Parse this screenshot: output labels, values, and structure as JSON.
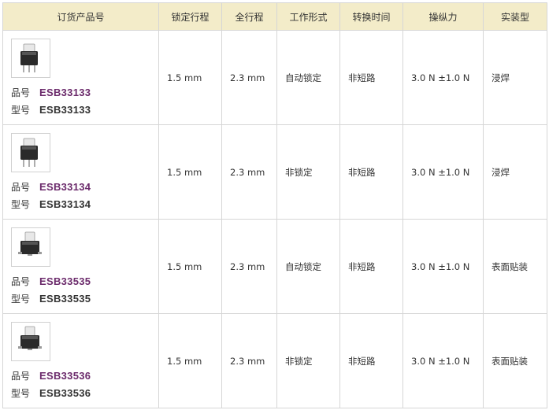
{
  "table": {
    "headers": [
      "订货产品号",
      "锁定行程",
      "全行程",
      "工作形式",
      "转换时间",
      "操纵力",
      "实装型"
    ],
    "label_part": "品号",
    "label_model": "型号",
    "rows": [
      {
        "part_no": "ESB33133",
        "model": "ESB33133",
        "lock_stroke": "1.5 mm",
        "full_stroke": "2.3 mm",
        "operation": "自动锁定",
        "switching": "非短路",
        "force": "3.0 N ±1.0 N",
        "mounting": "浸焊",
        "image_icon": "switch-dip-icon"
      },
      {
        "part_no": "ESB33134",
        "model": "ESB33134",
        "lock_stroke": "1.5 mm",
        "full_stroke": "2.3 mm",
        "operation": "非锁定",
        "switching": "非短路",
        "force": "3.0 N ±1.0 N",
        "mounting": "浸焊",
        "image_icon": "switch-dip-icon"
      },
      {
        "part_no": "ESB33535",
        "model": "ESB33535",
        "lock_stroke": "1.5 mm",
        "full_stroke": "2.3 mm",
        "operation": "自动锁定",
        "switching": "非短路",
        "force": "3.0 N ±1.0 N",
        "mounting": "表面贴装",
        "image_icon": "switch-smd-icon"
      },
      {
        "part_no": "ESB33536",
        "model": "ESB33536",
        "lock_stroke": "1.5 mm",
        "full_stroke": "2.3 mm",
        "operation": "非锁定",
        "switching": "非短路",
        "force": "3.0 N ±1.0 N",
        "mounting": "表面贴装",
        "image_icon": "switch-smd-icon"
      }
    ]
  },
  "colors": {
    "header_bg": "#f3ecc9",
    "border": "#d6d6d6",
    "link": "#6b2a6b"
  }
}
